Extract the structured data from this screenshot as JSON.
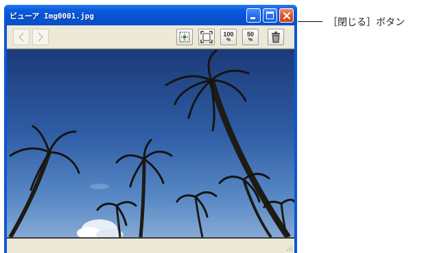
{
  "window": {
    "title": "ビューア Img0001.jpg",
    "controls": {
      "minimize": "minimize-icon",
      "maximize": "maximize-icon",
      "close": "close-icon"
    }
  },
  "toolbar": {
    "nav": {
      "previous": "<",
      "next": ">"
    },
    "tools": [
      {
        "name": "fit-to-window",
        "icon": "fit-window-icon"
      },
      {
        "name": "full-screen",
        "icon": "fullscreen-icon"
      },
      {
        "name": "zoom-100",
        "label": "100",
        "unit": "%"
      },
      {
        "name": "zoom-50",
        "label": "50",
        "unit": "%"
      },
      {
        "name": "delete",
        "icon": "trash-icon"
      }
    ]
  },
  "image": {
    "subject": "palm trees against blue sky"
  },
  "annotation": {
    "label": "［閉じる］ボタン"
  },
  "colors": {
    "titlebar": "#0a56d6",
    "close_button": "#e0522a",
    "client": "#ece9d8"
  }
}
